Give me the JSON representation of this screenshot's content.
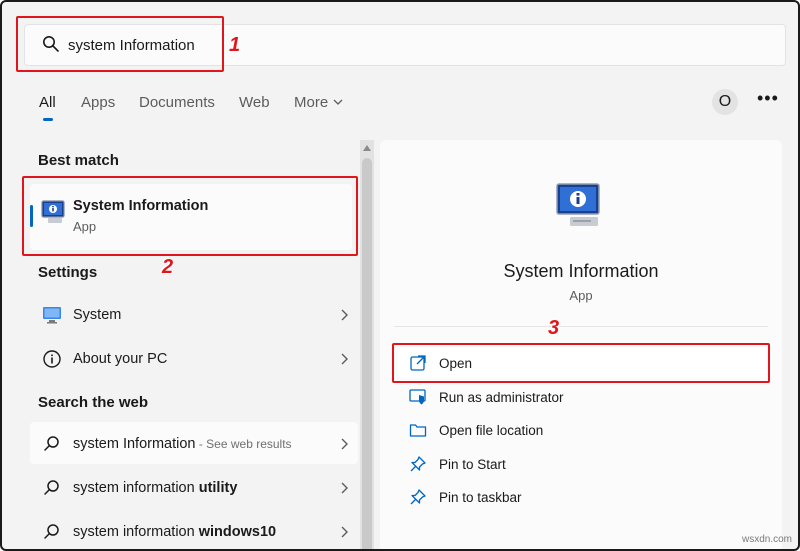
{
  "search": {
    "query": "system Information"
  },
  "annotations": {
    "step1": "1",
    "step2": "2",
    "step3": "3"
  },
  "tabs": [
    {
      "label": "All",
      "active": true
    },
    {
      "label": "Apps"
    },
    {
      "label": "Documents"
    },
    {
      "label": "Web"
    },
    {
      "label": "More"
    }
  ],
  "header": {
    "account_initial": "O",
    "more_options": "•••"
  },
  "best_match": {
    "heading": "Best match",
    "title": "System Information",
    "subtitle": "App",
    "icon": "system-information-icon"
  },
  "settings": {
    "heading": "Settings",
    "items": [
      {
        "label": "System",
        "icon": "monitor-icon"
      },
      {
        "label": "About your PC",
        "icon": "info-circle-icon"
      }
    ]
  },
  "web": {
    "heading": "Search the web",
    "results": [
      {
        "query": "system Information",
        "suffix": " - See web results"
      },
      {
        "prefix": "system information ",
        "bold": "utility"
      },
      {
        "prefix": "system information ",
        "bold": "windows10"
      }
    ]
  },
  "detail": {
    "title": "System Information",
    "subtitle": "App",
    "actions": [
      {
        "label": "Open",
        "icon": "open-external-icon"
      },
      {
        "label": "Run as administrator",
        "icon": "admin-shield-icon"
      },
      {
        "label": "Open file location",
        "icon": "folder-icon"
      },
      {
        "label": "Pin to Start",
        "icon": "pin-icon"
      },
      {
        "label": "Pin to taskbar",
        "icon": "pin-icon"
      }
    ]
  },
  "watermark": "wsxdn.com",
  "colors": {
    "accent": "#0067c0",
    "annotation": "#e0161c",
    "panel": "#fbfbfb",
    "background": "#f3f3f3"
  }
}
